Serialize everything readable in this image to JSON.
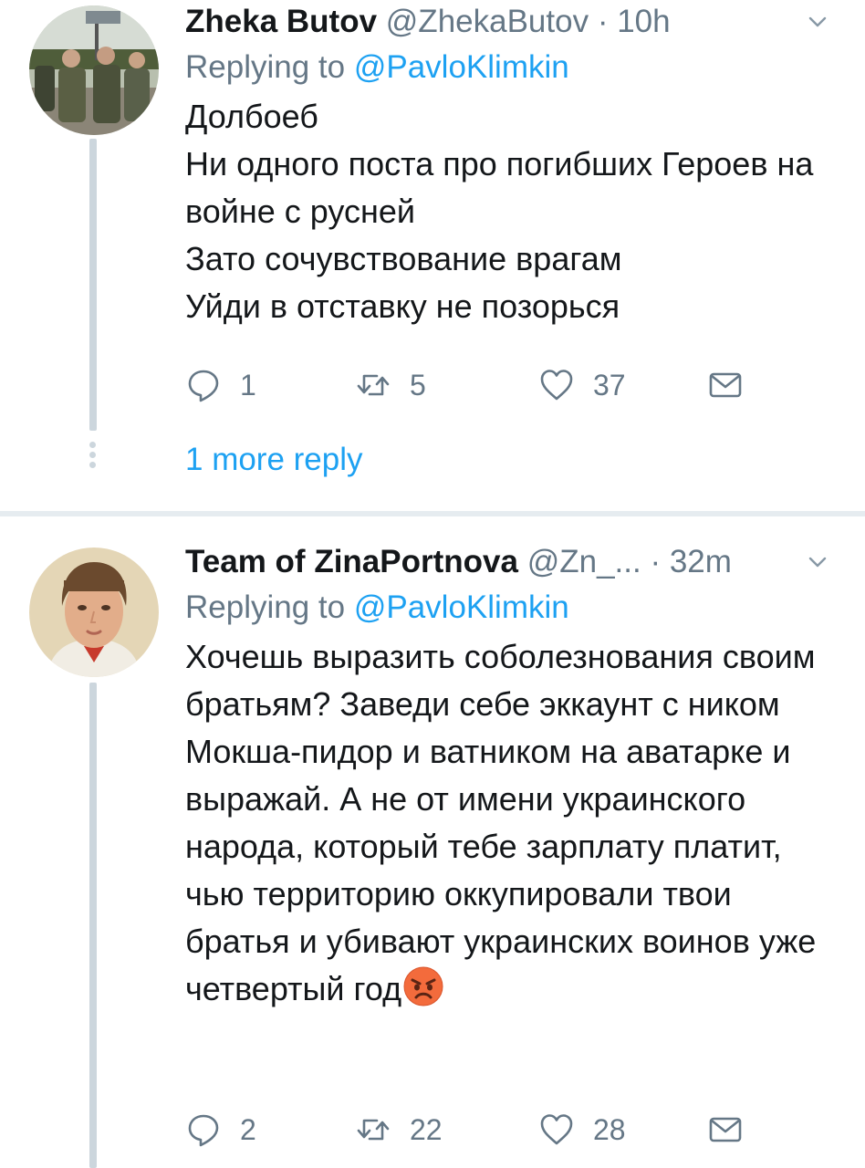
{
  "tweets": [
    {
      "name": "Zheka Butov",
      "handle": "@ZhekaButov",
      "separator": "·",
      "time": "10h",
      "replying_label": "Replying to",
      "replying_mention": "@PavloKlimkin",
      "body": "Долбоеб\nНи одного поста про погибших Героев на войне с русней\nЗато сочувствование врагам\nУйди в отставку не позорься",
      "counts": {
        "replies": "1",
        "retweets": "5",
        "likes": "37"
      },
      "more_replies": "1 more reply",
      "avatar": "soldiers-group-photo"
    },
    {
      "name": "Team of ZinaPortnova",
      "handle": "@Zn_...",
      "separator": "·",
      "time": "32m",
      "replying_label": "Replying to",
      "replying_mention": "@PavloKlimkin",
      "body": "Хочешь выразить соболезнования своим братьям? Заведи себе эккаунт с ником Мокша-пидор и ватником на аватарке и выражай. А не от имени украинского народа, который тебе зарплату платит, чью территорию оккупировали твои братья и убивают украинских воинов уже четвертый год",
      "body_emoji": "angry-face-emoji",
      "counts": {
        "replies": "2",
        "retweets": "22",
        "likes": "28"
      },
      "avatar": "girl-portrait-painting"
    }
  ],
  "icons": [
    "reply-icon",
    "retweet-icon",
    "like-icon",
    "direct-message-icon",
    "chevron-down-icon"
  ],
  "colors": {
    "link": "#1da1f2",
    "secondary": "#657786",
    "thread": "#ccd6dd",
    "divider": "#e6ecf0",
    "text": "#14171a"
  }
}
